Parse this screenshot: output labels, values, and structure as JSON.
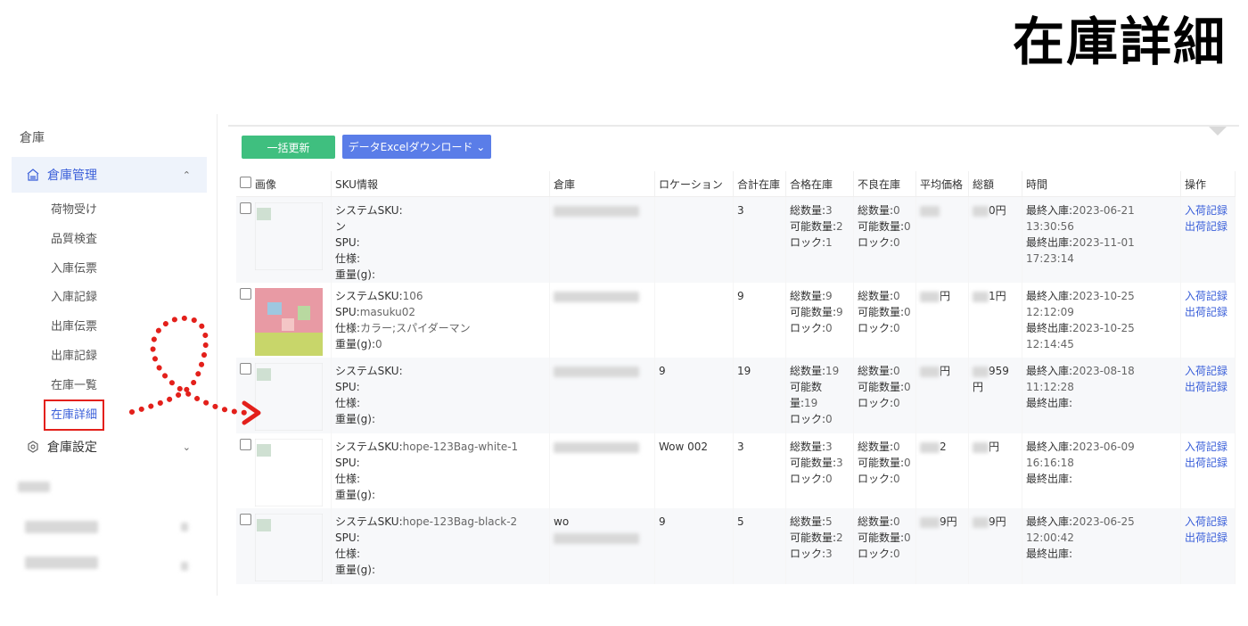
{
  "page_title": "在庫詳細",
  "sidebar": {
    "section": "倉庫",
    "group": "倉庫管理",
    "items": [
      {
        "label": "荷物受け"
      },
      {
        "label": "品質検査"
      },
      {
        "label": "入庫伝票"
      },
      {
        "label": "入庫記録"
      },
      {
        "label": "出庫伝票"
      },
      {
        "label": "出庫記録"
      },
      {
        "label": "在庫一覧"
      },
      {
        "label": "在庫詳細",
        "active": true
      }
    ],
    "group2": "倉庫設定"
  },
  "toolbar": {
    "bulk_update": "一括更新",
    "download": "データExcelダウンロード ⌄"
  },
  "table": {
    "headers": [
      "画像",
      "SKU情報",
      "倉庫",
      "ロケーション",
      "合計在庫",
      "合格在庫",
      "不良在庫",
      "平均価格",
      "総額",
      "時間",
      "操作"
    ],
    "labels": {
      "sku": "システムSKU:",
      "spu": "SPU:",
      "spec": "仕様:",
      "weight": "重量(g):",
      "total": "総数量:",
      "avail": "可能数量:",
      "lock": "ロック:",
      "last_in": "最終入庫:",
      "last_out": "最終出庫:",
      "op_in": "入荷記録",
      "op_out": "出荷記録"
    },
    "rows": [
      {
        "sku": "",
        "sku2": "ン",
        "spu": "",
        "spec": "",
        "weight": "",
        "warehouse": "",
        "location": "",
        "total": "3",
        "good_total": "3",
        "good_avail": "2",
        "good_lock": "1",
        "bad_total": "0",
        "bad_avail": "0",
        "bad_lock": "0",
        "avg": "",
        "sum": "0円",
        "last_in": "2023-06-21 13:30:56",
        "last_out": "2023-11-01 17:23:14"
      },
      {
        "sku": "106",
        "sku2": "",
        "spu": "masuku02",
        "spec": "カラー;スパイダーマン",
        "weight": "0",
        "warehouse": "",
        "location": "",
        "total": "9",
        "good_total": "9",
        "good_avail": "9",
        "good_lock": "0",
        "bad_total": "0",
        "bad_avail": "0",
        "bad_lock": "0",
        "avg": "円",
        "sum": "1円",
        "last_in": "2023-10-25 12:12:09",
        "last_out": "2023-10-25 12:14:45"
      },
      {
        "sku": "",
        "sku2": "",
        "spu": "",
        "spec": "",
        "weight": "",
        "warehouse": "",
        "location": "9",
        "total": "19",
        "good_total": "19",
        "good_avail": "19",
        "good_lock": "0",
        "bad_total": "0",
        "bad_avail": "0",
        "bad_lock": "0",
        "avg": "円",
        "sum": "959円",
        "last_in": "2023-08-18 11:12:28",
        "last_out": ""
      },
      {
        "sku": "hope-123Bag-white-1",
        "sku2": "",
        "spu": "",
        "spec": "",
        "weight": "",
        "warehouse": "",
        "location": "Wow 002",
        "total": "3",
        "good_total": "3",
        "good_avail": "3",
        "good_lock": "0",
        "bad_total": "0",
        "bad_avail": "0",
        "bad_lock": "0",
        "avg": "2",
        "sum": "円",
        "last_in": "2023-06-09 16:16:18",
        "last_out": ""
      },
      {
        "sku": "hope-123Bag-black-2",
        "sku2": "",
        "spu": "",
        "spec": "",
        "weight": "",
        "warehouse": "wo",
        "location": "9",
        "total": "5",
        "good_total": "5",
        "good_avail": "2",
        "good_lock": "3",
        "bad_total": "0",
        "bad_avail": "0",
        "bad_lock": "0",
        "avg": "9円",
        "sum": "9円",
        "last_in": "2023-06-25 12:00:42",
        "last_out": ""
      }
    ]
  }
}
